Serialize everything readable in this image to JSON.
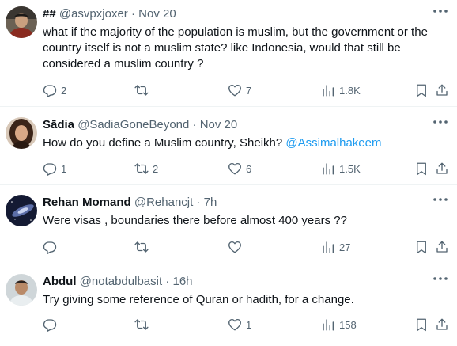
{
  "tweets": [
    {
      "name": "##",
      "handle": "@asvpxjoxer",
      "time": "Nov 20",
      "text": "what if the majority of the population is muslim, but the government or the country itself is not a muslim state? like Indonesia, would that still be considered a muslim country ?",
      "replies": "2",
      "retweets": "",
      "likes": "7",
      "views": "1.8K"
    },
    {
      "name": "Sādia",
      "handle": "@SadiaGoneBeyond",
      "time": "Nov 20",
      "text": "How do you define a Muslim country, Sheikh?",
      "mention": "@Assimalhakeem",
      "replies": "1",
      "retweets": "2",
      "likes": "6",
      "views": "1.5K"
    },
    {
      "name": "Rehan Momand",
      "handle": "@Rehancjt",
      "time": "7h",
      "text": "Were visas , boundaries there before almost 400 years ??",
      "replies": "",
      "retweets": "",
      "likes": "",
      "views": "27"
    },
    {
      "name": "Abdul",
      "handle": "@notabdulbasit",
      "time": "16h",
      "text": "Try giving some reference of Quran or hadith, for a change.",
      "replies": "",
      "retweets": "",
      "likes": "1",
      "views": "158"
    }
  ],
  "separator": "·",
  "colors": {
    "text": "#0f1419",
    "secondary": "#536471",
    "link": "#1d9bf0",
    "border": "#eff3f4"
  },
  "icons": [
    "more-icon",
    "reply-icon",
    "retweet-icon",
    "like-icon",
    "views-icon",
    "bookmark-icon",
    "share-icon"
  ]
}
